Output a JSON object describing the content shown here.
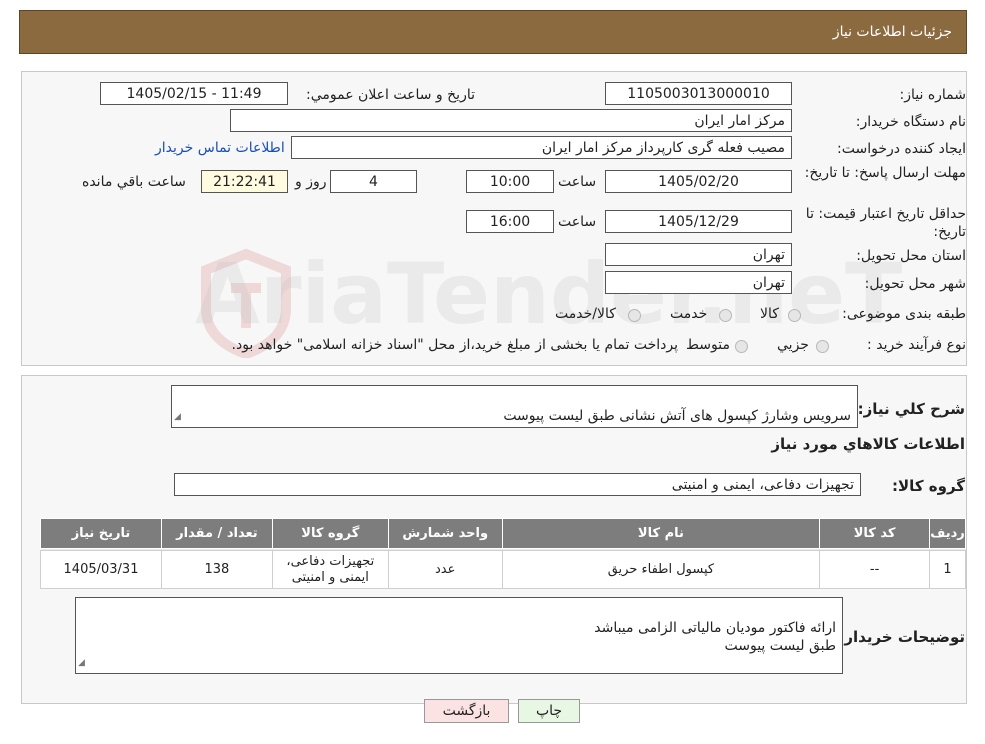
{
  "header": {
    "title": "جزئیات اطلاعات نیاز"
  },
  "watermark": "AriaTender.neT",
  "form": {
    "need_number_label": "شماره نیاز:",
    "need_number": "1105003013000010",
    "announce_label": "تاریخ و ساعت اعلان عمومي:",
    "announce_value": "1405/02/15 - 11:49",
    "buyer_org_label": "نام دستگاه خريدار:",
    "buyer_org": "مرکز امار ایران",
    "creator_label": "ايجاد کننده درخواست:",
    "creator": "مصیب فعله گری کارپرداز مرکز امار ایران",
    "contact_link": "اطلاعات تماس خريدار",
    "reply_deadline_label": "مهلت ارسال پاسخ: تا تاريخ:",
    "reply_date": "1405/02/20",
    "time_label": "ساعت",
    "reply_time": "10:00",
    "days_value": "4",
    "days_label": "روز و",
    "remaining_time": "21:22:41",
    "remaining_label": "ساعت باقي مانده",
    "price_validity_label": "حداقل تاريخ اعتبار قيمت: تا تاريخ:",
    "validity_date": "1405/12/29",
    "validity_time": "16:00",
    "province_label": "استان محل تحويل:",
    "province": "تهران",
    "city_label": "شهر محل تحويل:",
    "city": "تهران",
    "category_label": "طبقه بندی موضوعی:",
    "category_options": [
      "کالا",
      "خدمت",
      "کالا/خدمت"
    ],
    "process_label": "نوع فرآيند خريد :",
    "process_options": [
      "جزيي",
      "متوسط"
    ],
    "process_note": "پرداخت تمام یا بخشی از مبلغ خرید،از محل \"اسناد خزانه اسلامی\" خواهد بود."
  },
  "details": {
    "description_label": "شرح کلي نياز:",
    "description": "سرویس وشارژ کپسول های آتش نشانی طبق لیست پیوست",
    "goods_info_title": "اطلاعات کالاهاي مورد نياز",
    "goods_group_label": "گروه کالا:",
    "goods_group": "تجهیزات دفاعی، ایمنی و امنیتی"
  },
  "table": {
    "headers": [
      "رديف",
      "کد کالا",
      "نام کالا",
      "واحد شمارش",
      "گروه کالا",
      "تعداد / مقدار",
      "تاريخ نياز"
    ],
    "rows": [
      [
        "1",
        "--",
        "کپسول اطفاء حریق",
        "عدد",
        "تجهیزات دفاعی، ایمنی و امنیتی",
        "138",
        "1405/03/31"
      ]
    ]
  },
  "buyer_notes": {
    "label": "توضيحات خريدار:",
    "text": "ارائه فاکتور مودیان مالیاتی الزامی میباشد\nطبق لیست پیوست"
  },
  "buttons": {
    "print": "چاپ",
    "back": "بازگشت"
  }
}
